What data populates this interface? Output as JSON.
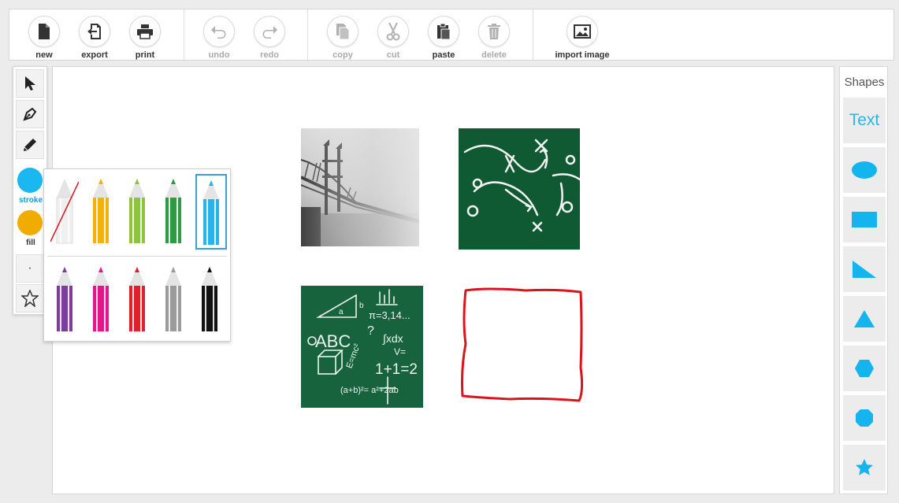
{
  "toolbar": {
    "new_label": "new",
    "export_label": "export",
    "print_label": "print",
    "undo_label": "undo",
    "redo_label": "redo",
    "copy_label": "copy",
    "cut_label": "cut",
    "paste_label": "paste",
    "delete_label": "delete",
    "import_label": "import image"
  },
  "left_tools": {
    "stroke_label": "stroke",
    "fill_label": "fill",
    "stroke_color": "#1bb7f0",
    "fill_color": "#f0ac00",
    "line_width_label": "·"
  },
  "palette": {
    "pencils": [
      {
        "color": "#ffffff",
        "name": "none"
      },
      {
        "color": "#f2b20a",
        "name": "yellow"
      },
      {
        "color": "#8cc43c",
        "name": "green"
      },
      {
        "color": "#2f9a44",
        "name": "dark-green"
      },
      {
        "color": "#27b4ec",
        "name": "blue",
        "selected": true
      },
      {
        "color": "#7b3f98",
        "name": "purple"
      },
      {
        "color": "#e5168c",
        "name": "pink"
      },
      {
        "color": "#e0202a",
        "name": "red"
      },
      {
        "color": "#9b9b9b",
        "name": "gray"
      },
      {
        "color": "#111111",
        "name": "black"
      }
    ]
  },
  "shapes": {
    "title": "Shapes",
    "text_label": "Text",
    "accent": "#14b4ee"
  },
  "canvas": {
    "chalk_formulas": {
      "abc": "ABC",
      "pi": "π=3,14...",
      "integral": "∫xdx",
      "sum": "1+1=2",
      "binomial": "(a+b)²= a²+2ab",
      "v": "V=",
      "emc": "E=mc²",
      "a": "a",
      "b": "b",
      "q": "?"
    },
    "freehand_color": "#d8151c"
  }
}
